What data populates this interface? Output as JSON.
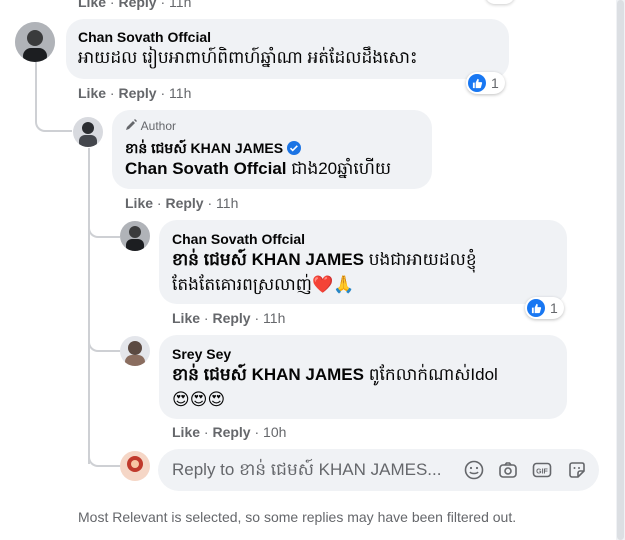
{
  "top_partial": {
    "like": "Like",
    "reply": "Reply",
    "time": "11h"
  },
  "comments": [
    {
      "author": "Chan Sovath Offcial",
      "text": "អាយដល រៀបអាពាហ៍ពិពាហ៍ឆ្នាំណា អត់ដែលដឹងសោះ",
      "reaction_count": "1",
      "like": "Like",
      "reply": "Reply",
      "time": "11h"
    },
    {
      "author_badge": "Author",
      "author": "ខាន់ ជេមស៍ KHAN JAMES",
      "mention": "Chan Sovath Offcial",
      "text": " ជាង20ឆ្នាំហើយ",
      "like": "Like",
      "reply": "Reply",
      "time": "11h"
    },
    {
      "author": "Chan Sovath Offcial",
      "mention": "ខាន់ ជេមស៍ KHAN JAMES",
      "text": " បងជាអាយដលខ្ញុំ",
      "text_line2": "តែងតែគោរពស្រលាញ់",
      "emoji": "❤️🙏",
      "reaction_count": "1",
      "like": "Like",
      "reply": "Reply",
      "time": "11h"
    },
    {
      "author": "Srey Sey",
      "mention": "ខាន់ ជេមស៍ KHAN JAMES",
      "text": " ពូកែលាក់ណាស់Idol",
      "emoji": "😍😍😍",
      "like": "Like",
      "reply": "Reply",
      "time": "10h"
    }
  ],
  "reply_box": {
    "placeholder": "Reply to ខាន់ ជេមស៍ KHAN JAMES..."
  },
  "footer_note": "Most Relevant is selected, so some replies may have been filtered out.",
  "colors": {
    "like_blue": "#1877f2",
    "bubble_bg": "#f0f2f5",
    "meta_gray": "#65676b"
  }
}
